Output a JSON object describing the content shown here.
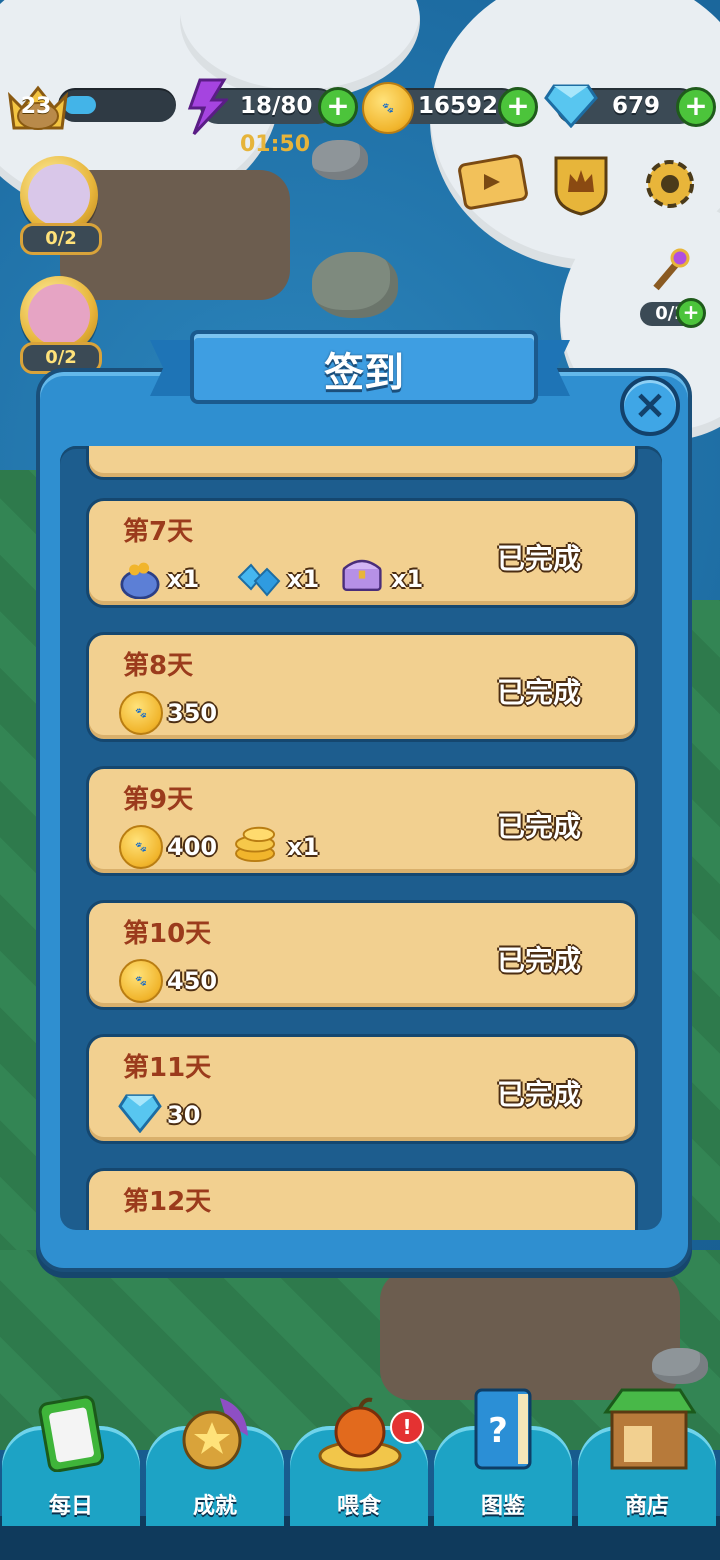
{
  "hud": {
    "level": "23",
    "xp_progress": 0.3,
    "energy": "18/80",
    "energy_timer": "01:50",
    "coins": "16592",
    "gems": "679"
  },
  "left_side": [
    {
      "count": "0/2"
    },
    {
      "count": "0/2"
    }
  ],
  "right_side": {
    "wand_count": "0/2"
  },
  "dialog": {
    "title": "签到",
    "close": "×",
    "entries": [
      {
        "day": "第7天",
        "status": "已完成",
        "rewards": [
          {
            "icon": "coin-bag-icon",
            "text": "x1"
          },
          {
            "icon": "blue-gems-icon",
            "text": "x1"
          },
          {
            "icon": "treasure-chest-icon",
            "text": "x1"
          }
        ]
      },
      {
        "day": "第8天",
        "status": "已完成",
        "rewards": [
          {
            "icon": "paw-coin-icon",
            "text": "350"
          }
        ]
      },
      {
        "day": "第9天",
        "status": "已完成",
        "rewards": [
          {
            "icon": "paw-coin-icon",
            "text": "400"
          },
          {
            "icon": "coin-stack-icon",
            "text": "x1"
          }
        ]
      },
      {
        "day": "第10天",
        "status": "已完成",
        "rewards": [
          {
            "icon": "paw-coin-icon",
            "text": "450"
          }
        ]
      },
      {
        "day": "第11天",
        "status": "已完成",
        "rewards": [
          {
            "icon": "diamond-icon",
            "text": "30"
          }
        ]
      },
      {
        "day": "第12天",
        "status": "",
        "rewards": []
      }
    ]
  },
  "nav": [
    {
      "label": "每日",
      "icon": "clipboard-icon"
    },
    {
      "label": "成就",
      "icon": "star-medal-icon"
    },
    {
      "label": "喂食",
      "icon": "apple-icon",
      "alert": "!"
    },
    {
      "label": "图鉴",
      "icon": "book-icon"
    },
    {
      "label": "商店",
      "icon": "shop-icon"
    }
  ],
  "colors": {
    "card": "#f2d090",
    "day_label": "#9b3b1c",
    "dialog": "#2f8fd0",
    "nav_tab": "#1da3c5"
  }
}
